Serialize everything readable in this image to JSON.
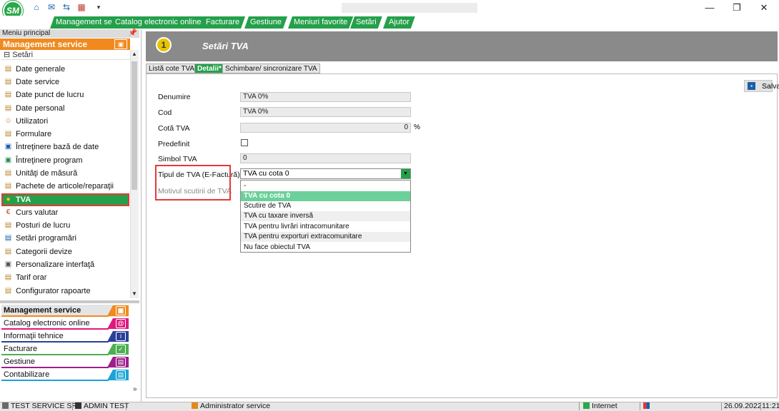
{
  "window": {
    "minimize": "—",
    "restore": "❐",
    "close": "✕"
  },
  "app": {
    "logo_text": "SM"
  },
  "quick_access": [
    "⌂",
    "✉",
    "⇆",
    "▦",
    "▾"
  ],
  "menu_tabs": [
    "Management service",
    "Catalog electronic online",
    "Facturare",
    "Gestiune",
    "Meniuri favorite",
    "Setări",
    "Ajutor"
  ],
  "sidebar": {
    "header": "Meniu principal",
    "pin": "📌",
    "section_title": "Management service",
    "group": "⊟ Setări",
    "items": [
      {
        "label": "Date generale",
        "icon": "▤"
      },
      {
        "label": "Date service",
        "icon": "▤"
      },
      {
        "label": "Date punct de lucru",
        "icon": "▤"
      },
      {
        "label": "Date personal",
        "icon": "▤"
      },
      {
        "label": "Utilizatori",
        "icon": "☺"
      },
      {
        "label": "Formulare",
        "icon": "▤"
      },
      {
        "label": "Întreţinere bază de date",
        "icon": "▣"
      },
      {
        "label": "Întreţinere program",
        "icon": "▣"
      },
      {
        "label": "Unităţi de măsură",
        "icon": "▤"
      },
      {
        "label": "Pachete de articole/reparaţii",
        "icon": "▤"
      },
      {
        "label": "TVA",
        "icon": "●"
      },
      {
        "label": "Curs valutar",
        "icon": "€"
      },
      {
        "label": "Posturi de lucru",
        "icon": "▤"
      },
      {
        "label": "Setări programări",
        "icon": "▤"
      },
      {
        "label": "Categorii devize",
        "icon": "▤"
      },
      {
        "label": "Personalizare interfaţă",
        "icon": "▣"
      },
      {
        "label": "Tarif orar",
        "icon": "▤"
      },
      {
        "label": "Configurator rapoarte",
        "icon": "▤"
      }
    ],
    "modules": [
      {
        "label": "Management service",
        "color": "#f08a1e",
        "icon": "▣"
      },
      {
        "label": "Catalog electronic online",
        "color": "#e0197d",
        "icon": "@"
      },
      {
        "label": "Informaţii tehnice",
        "color": "#2b3f9a",
        "icon": "i"
      },
      {
        "label": "Facturare",
        "color": "#4caf50",
        "icon": "✓"
      },
      {
        "label": "Gestiune",
        "color": "#9c1f8a",
        "icon": "▤"
      },
      {
        "label": "Contabilizare",
        "color": "#1aa3d6",
        "icon": "▤"
      }
    ],
    "more": "»"
  },
  "page": {
    "title": "Setări TVA",
    "icon_text": "1",
    "tabs": [
      "Listă cote TVA",
      "Detalii*",
      "Schimbare/ sincronizare TVA"
    ],
    "save_label": "Salvare"
  },
  "form": {
    "denumire_label": "Denumire",
    "denumire_value": "TVA 0%",
    "cod_label": "Cod",
    "cod_value": "TVA 0%",
    "cota_label": "Cotă TVA",
    "cota_value": "0",
    "cota_unit": "%",
    "predefinit_label": "Predefinit",
    "simbol_label": "Simbol TVA",
    "simbol_value": "0",
    "tip_label": "Tipul de TVA (E-Factură)",
    "tip_value": "TVA cu cota 0",
    "motiv_label": "Motivul scutirii de TVA",
    "options": [
      "-",
      "TVA cu cota 0",
      "Scutire de TVA",
      "TVA cu taxare inversă",
      "TVA pentru livrări intracomunitare",
      "TVA pentru exporturi extracomunitare",
      "Nu face obiectul TVA"
    ]
  },
  "status": {
    "company": "TEST SERVICE SRL",
    "user": "ADMIN TEST",
    "role": "Administrator service",
    "connection": "Internet",
    "date": "26.09.2022",
    "time": "11:21"
  }
}
